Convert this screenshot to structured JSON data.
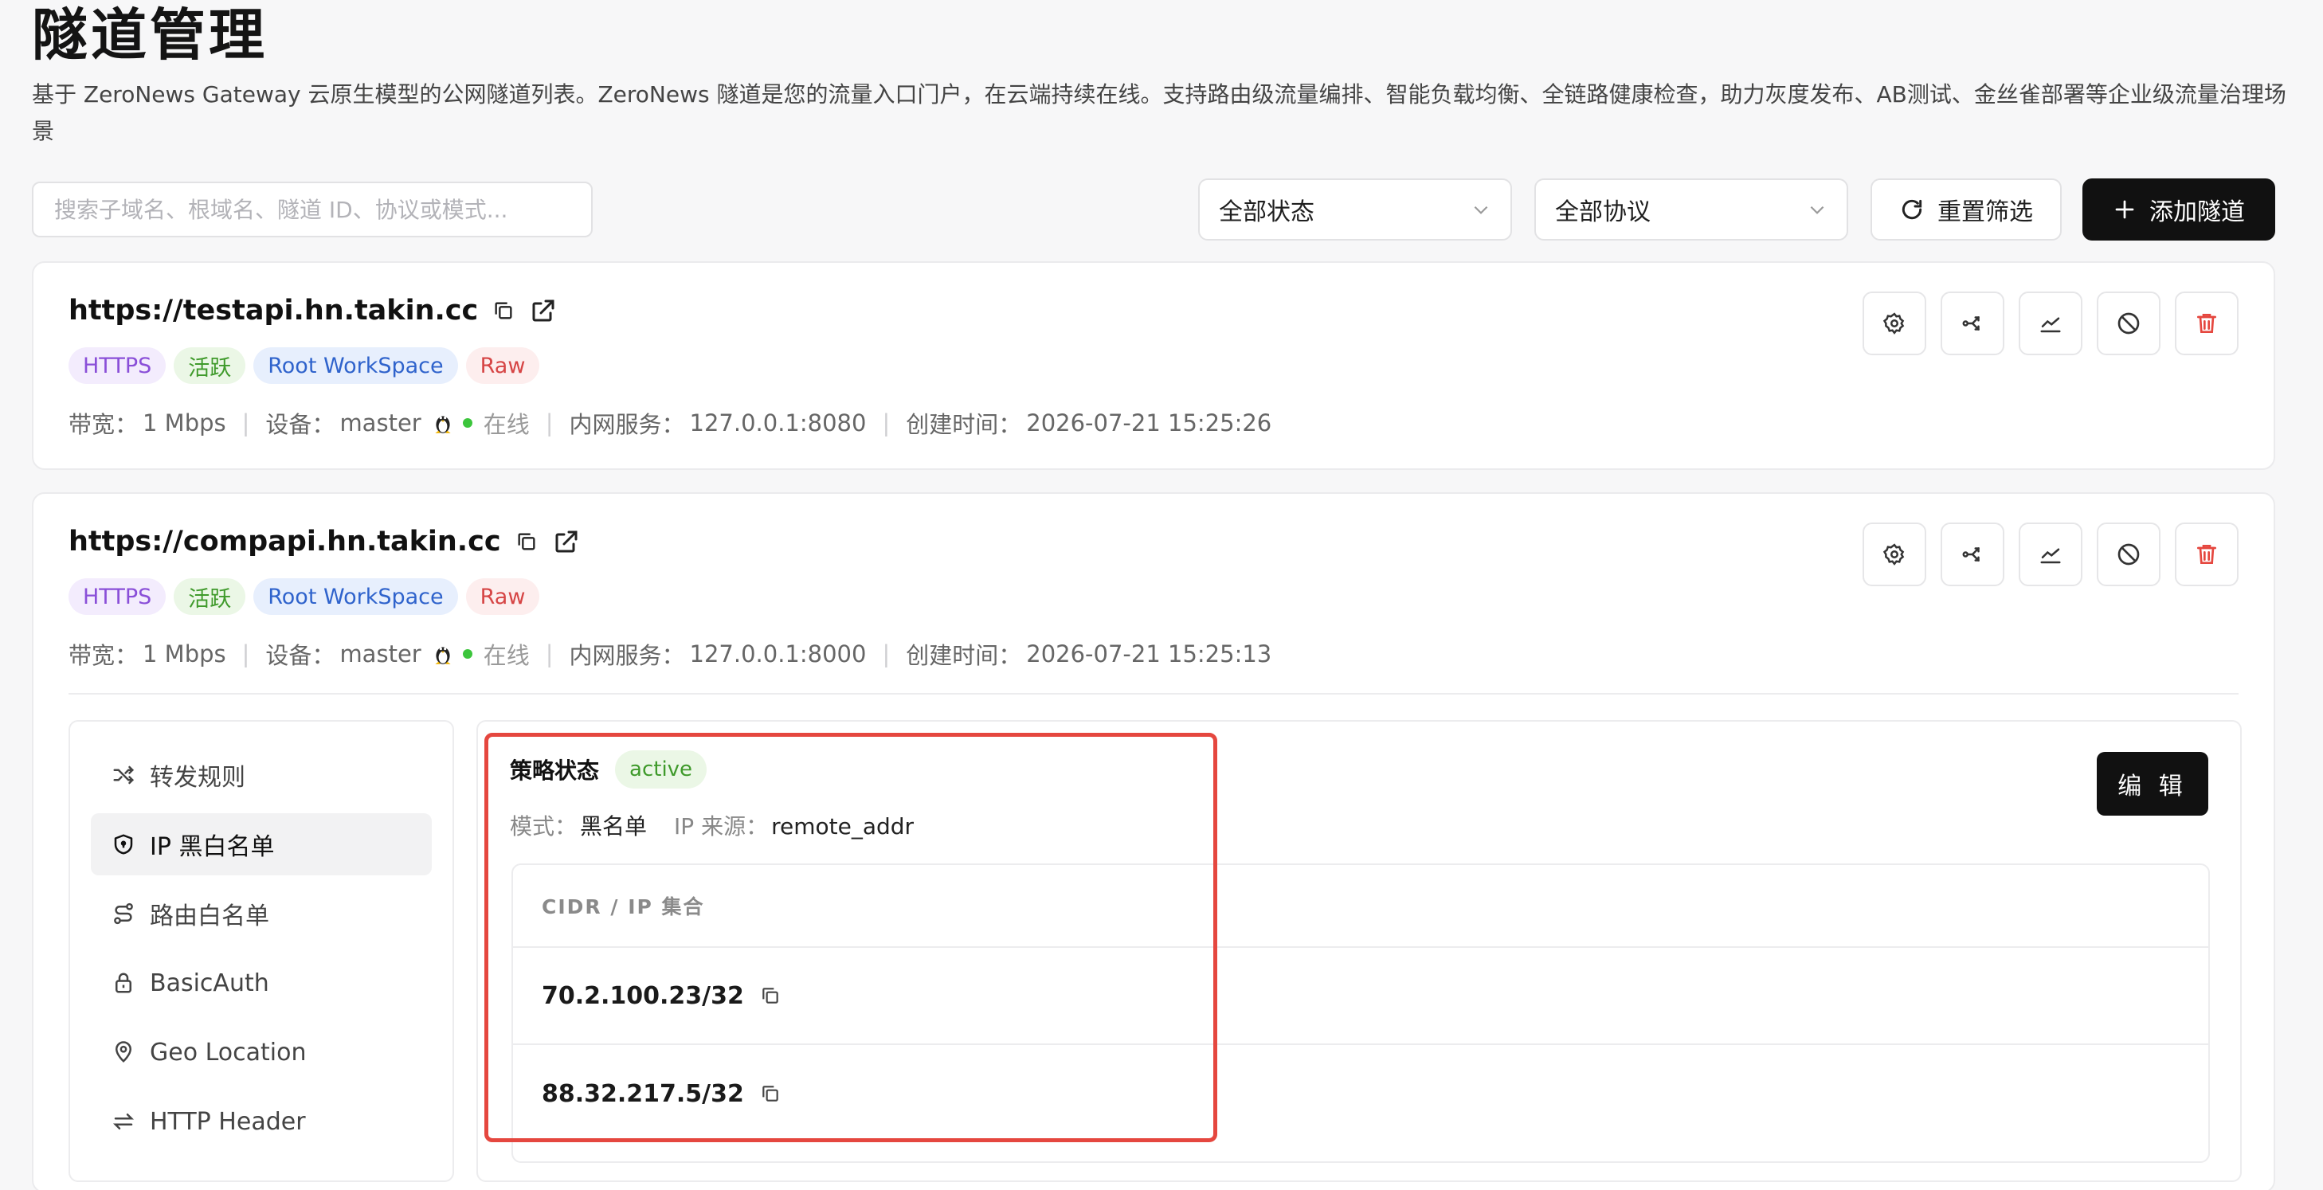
{
  "page": {
    "title": "隧道管理",
    "description": "基于 ZeroNews Gateway 云原生模型的公网隧道列表。ZeroNews 隧道是您的流量入口门户，在云端持续在线。支持路由级流量编排、智能负载均衡、全链路健康检查，助力灰度发布、AB测试、金丝雀部署等企业级流量治理场景"
  },
  "toolbar": {
    "search_placeholder": "搜索子域名、根域名、隧道 ID、协议或模式...",
    "status_filter": "全部状态",
    "protocol_filter": "全部协议",
    "reset_label": "重置筛选",
    "add_label": "添加隧道"
  },
  "tunnels": [
    {
      "url": "https://testapi.hn.takin.cc",
      "tags": [
        "HTTPS",
        "活跃",
        "Root WorkSpace",
        "Raw"
      ],
      "bandwidth_label": "带宽：",
      "bandwidth": "1 Mbps",
      "device_label": "设备：",
      "device": "master",
      "status": "在线",
      "service_label": "内网服务：",
      "service": "127.0.0.1:8080",
      "created_label": "创建时间：",
      "created": "2026-07-21 15:25:26"
    },
    {
      "url": "https://compapi.hn.takin.cc",
      "tags": [
        "HTTPS",
        "活跃",
        "Root WorkSpace",
        "Raw"
      ],
      "bandwidth_label": "带宽：",
      "bandwidth": "1 Mbps",
      "device_label": "设备：",
      "device": "master",
      "status": "在线",
      "service_label": "内网服务：",
      "service": "127.0.0.1:8000",
      "created_label": "创建时间：",
      "created": "2026-07-21 15:25:13"
    }
  ],
  "sidebar": {
    "items": [
      {
        "label": "转发规则",
        "icon": "shuffle-icon"
      },
      {
        "label": "IP 黑白名单",
        "icon": "shield-icon"
      },
      {
        "label": "路由白名单",
        "icon": "route-icon"
      },
      {
        "label": "BasicAuth",
        "icon": "lock-icon"
      },
      {
        "label": "Geo Location",
        "icon": "map-pin-icon"
      },
      {
        "label": "HTTP Header",
        "icon": "arrows-exchange-icon"
      }
    ],
    "selected_index": 1
  },
  "policy": {
    "status_label": "策略状态",
    "status_value": "active",
    "mode_label": "模式：",
    "mode_value": "黑名单",
    "source_label": "IP 来源：",
    "source_value": "remote_addr",
    "edit_label": "编 辑",
    "table_header": "CIDR / IP 集合",
    "rows": [
      "70.2.100.23/32",
      "88.32.217.5/32"
    ]
  },
  "colors": {
    "accent_dark": "#111111",
    "online_dot": "#3cc53c",
    "highlight": "#e5473f",
    "delete_red": "#e5473f"
  }
}
